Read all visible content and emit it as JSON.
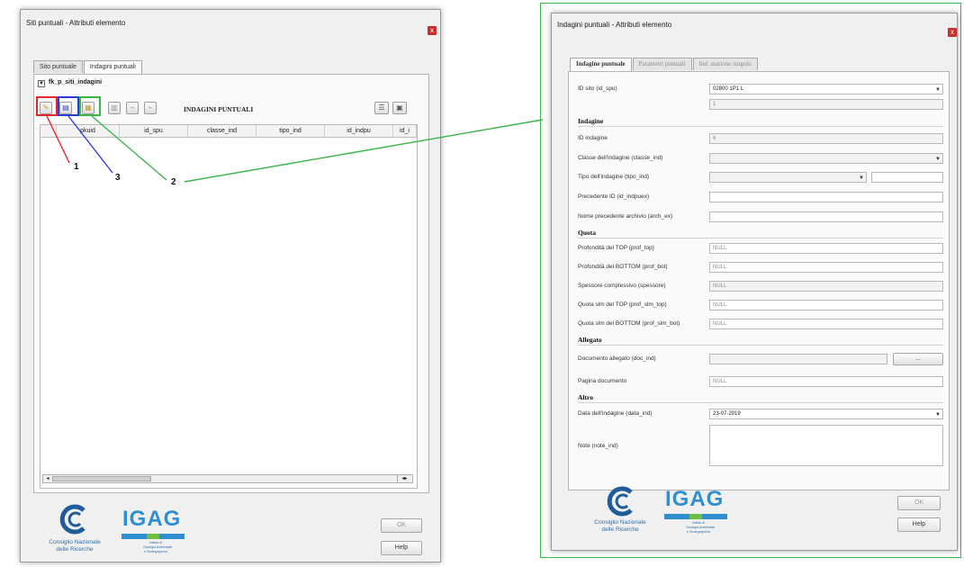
{
  "left_dialog": {
    "title": "Siti puntuali - Attributi elemento",
    "close": "x",
    "tabs": [
      "Sito puntuale",
      "Indagini puntuali"
    ],
    "relation_label": "fk_p_siti_indagini",
    "section_title": "INDAGINI PUNTUALI",
    "columns": [
      "pkuid",
      "id_spu",
      "classe_ind",
      "tipo_ind",
      "id_indpu",
      "id_i"
    ],
    "ok": "OK",
    "help": "Help"
  },
  "annotations": {
    "one": "1",
    "two": "2",
    "three": "3",
    "colors": {
      "one": "#e8252b",
      "two": "#39b54a",
      "three": "#2b3bd6"
    }
  },
  "right_dialog": {
    "title": "Indagini puntuali - Attributi elemento",
    "close": "x",
    "tabs": [
      "Indagine puntuale",
      "Parametri puntuali",
      "Ind. stazione singolo"
    ],
    "fields": {
      "id_sito_label": "ID sito (id_spu)",
      "id_sito_value": "02800 1P1 L",
      "id_sito_num": "1",
      "indagine_section": "Indagine",
      "id_indagine_label": "ID indagine",
      "id_indagine_value": "6",
      "classe_label": "Classe dell'indagine (classe_ind)",
      "tipo_label": "Tipo dell'indagine (tipo_ind)",
      "prec_id_label": "Precedente ID (id_indpuex)",
      "nome_prec_label": "Nome precedente archivio (arch_ex)",
      "quota_section": "Quota",
      "prof_top_label": "Profondità del TOP (prof_top)",
      "prof_bot_label": "Profondità del BOTTOM (prof_bot)",
      "spessore_label": "Spessore complessivo (spessore)",
      "quota_top_label": "Quota slm del TOP (prof_slm_top)",
      "quota_bot_label": "Quota slm del BOTTOM (prof_slm_bot)",
      "null_value": "NULL",
      "allegato_section": "Allegato",
      "doc_label": "Documento allegato (doc_ind)",
      "browse_label": "...",
      "pagina_label": "Pagina documento",
      "altro_section": "Altro",
      "data_label": "Data dell'indagine (data_ind)",
      "data_value": "23-07-2019",
      "note_label": "Note (note_ind)"
    },
    "ok": "OK",
    "help": "Help"
  },
  "logos": {
    "cnr_line1": "Consiglio Nazionale",
    "cnr_line2": "delle Ricerche",
    "igag": "IGAG",
    "igag_sub1": "Istituto di",
    "igag_sub2": "Geologia Ambientale",
    "igag_sub3": "e Geoingegneria"
  }
}
